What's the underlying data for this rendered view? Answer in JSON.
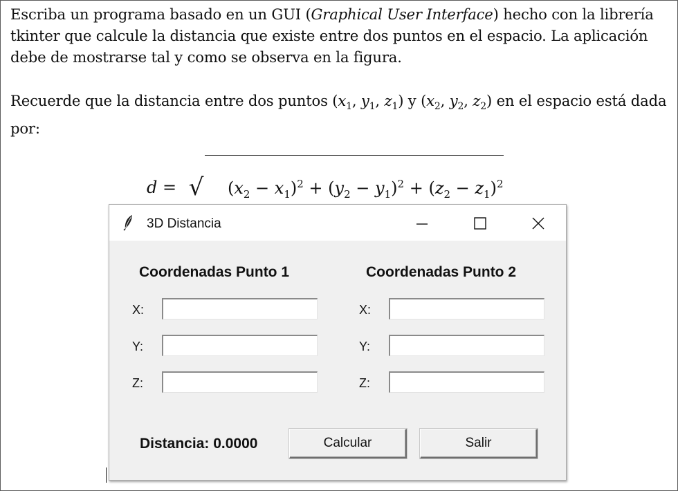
{
  "document": {
    "p1": {
      "before": "Escriba un programa basado en un GUI (",
      "italic": "Graphical User Interface",
      "after": ") hecho con la librería tkinter que calcule la distancia que existe entre dos puntos en el espacio. La aplicación debe de mostrarse tal y como se observa en la figura."
    },
    "p2": {
      "text_a": "Recuerde que la distancia entre dos puntos (",
      "x1": "x",
      "s1a": "1",
      "c1": ", ",
      "y1": "y",
      "s1b": "1",
      "c2": ", ",
      "z1": "z",
      "s1c": "1",
      "mid": ") y (",
      "x2": "x",
      "s2a": "2",
      "c3": ", ",
      "y2": "y",
      "s2b": "2",
      "c4": ", ",
      "z2": "z",
      "s2c": "2",
      "text_b": ") en el espacio está dada por:"
    },
    "formula": {
      "lhs": "d",
      "eq": " = ",
      "sqrt": "√",
      "t1_open": "(",
      "t1_a": "x",
      "t1_a_sub": "2",
      "t1_minus": " − ",
      "t1_b": "x",
      "t1_b_sub": "1",
      "t1_close": ")",
      "t1_sup": "2",
      "plus1": " + ",
      "t2_open": "(",
      "t2_a": "y",
      "t2_a_sub": "2",
      "t2_minus": " − ",
      "t2_b": "y",
      "t2_b_sub": "1",
      "t2_close": ")",
      "t2_sup": "2",
      "plus2": " + ",
      "t3_open": "(",
      "t3_a": "z",
      "t3_a_sub": "2",
      "t3_minus": " − ",
      "t3_b": "z",
      "t3_b_sub": "1",
      "t3_close": ")",
      "t3_sup": "2"
    }
  },
  "window": {
    "title": "3D Distancia",
    "icons": {
      "app": "feather-icon",
      "minimize": "minimize-icon",
      "maximize": "maximize-icon",
      "close": "close-icon"
    },
    "punto1": {
      "heading": "Coordenadas Punto 1",
      "x_label": "X:",
      "y_label": "Y:",
      "z_label": "Z:",
      "x_value": "",
      "y_value": "",
      "z_value": ""
    },
    "punto2": {
      "heading": "Coordenadas Punto 2",
      "x_label": "X:",
      "y_label": "Y:",
      "z_label": "Z:",
      "x_value": "",
      "y_value": "",
      "z_value": ""
    },
    "result_label": "Distancia: 0.0000",
    "calc_button": "Calcular",
    "exit_button": "Salir"
  }
}
